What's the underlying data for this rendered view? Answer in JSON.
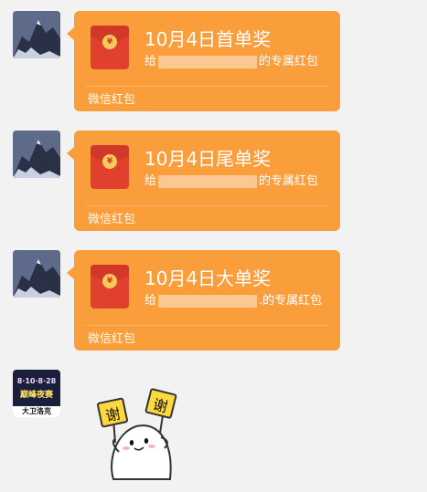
{
  "messages": [
    {
      "title": "10月4日首单奖",
      "prefix": "给",
      "suffix": "的专属红包",
      "footer": "微信红包"
    },
    {
      "title": "10月4日尾单奖",
      "prefix": "给",
      "suffix": "的专属红包",
      "footer": "微信红包"
    },
    {
      "title": "10月4日大单奖",
      "prefix": "给",
      "suffix": ".的专属红包",
      "footer": "微信红包"
    }
  ],
  "envelope_symbol": "¥",
  "sticker_avatar": {
    "top_text": "8·10·8·28",
    "mid_text": "巅峰夜赛",
    "banner": "大卫洛克"
  },
  "sticker": {
    "sign_left": "谢",
    "sign_right": "谢"
  },
  "colors": {
    "bubble": "#fa9d3b",
    "envelope": "#e1402f",
    "background": "#f2f2f2"
  }
}
